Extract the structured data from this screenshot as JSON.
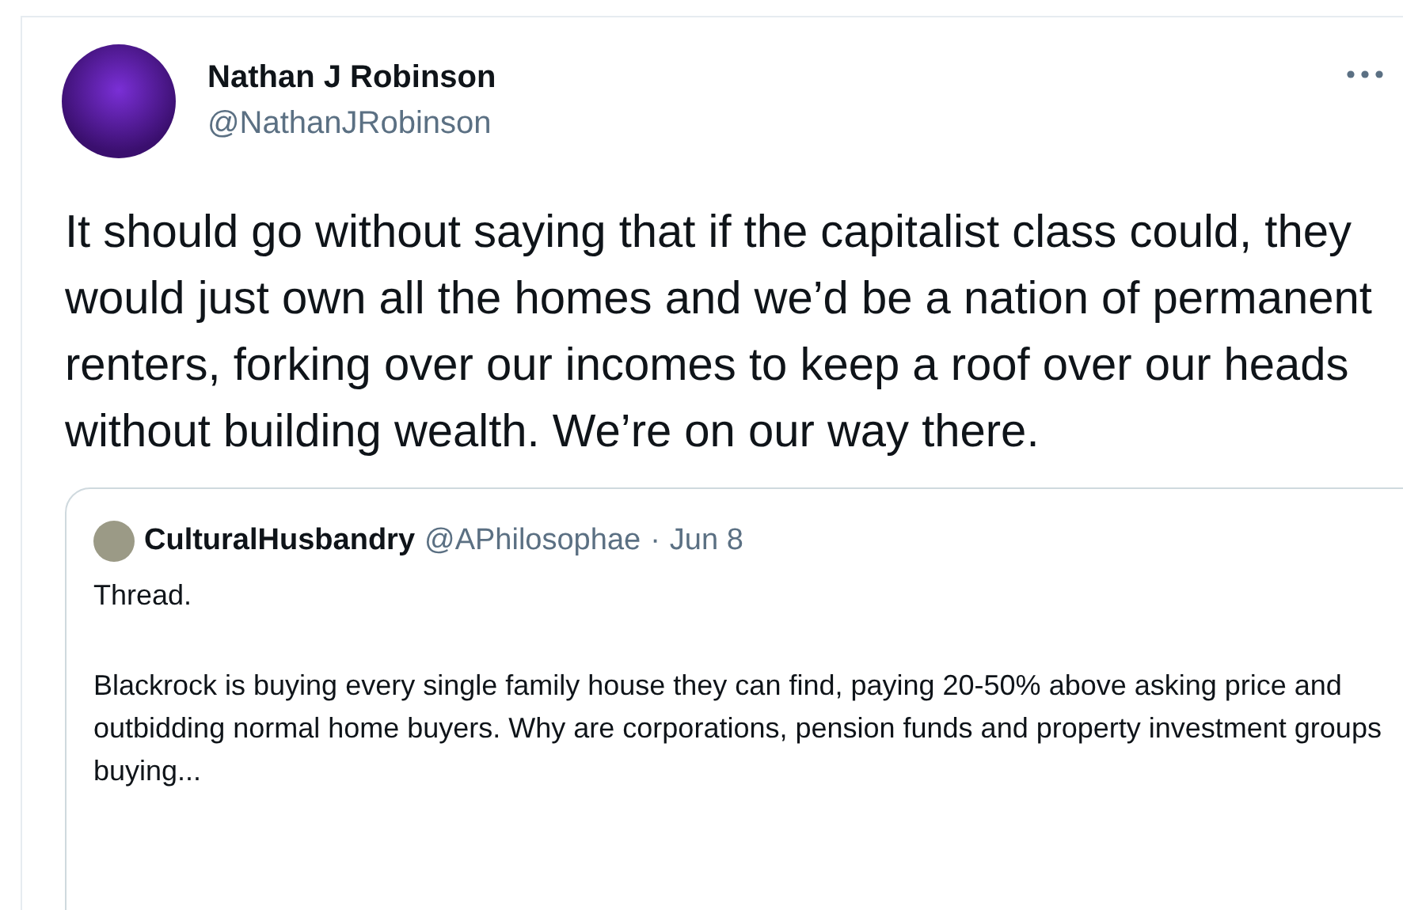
{
  "author": {
    "name": "Nathan J Robinson",
    "handle": "@NathanJRobinson"
  },
  "text": "It should go without saying that if the capitalist class could, they would just own all the homes and we’d be a nation of permanent renters, forking over our incomes to keep a roof over our heads without building wealth. We’re on our way there.",
  "quoted_tweet": {
    "name": "CulturalHusbandry",
    "handle": "@APhilosophae",
    "separator": "·",
    "date": "Jun 8",
    "paragraphs": [
      "Thread.",
      "Blackrock is buying every single family house they can find, paying 20-50% above asking price and outbidding normal home buyers. Why are corporations, pension funds and property investment groups buying..."
    ]
  }
}
